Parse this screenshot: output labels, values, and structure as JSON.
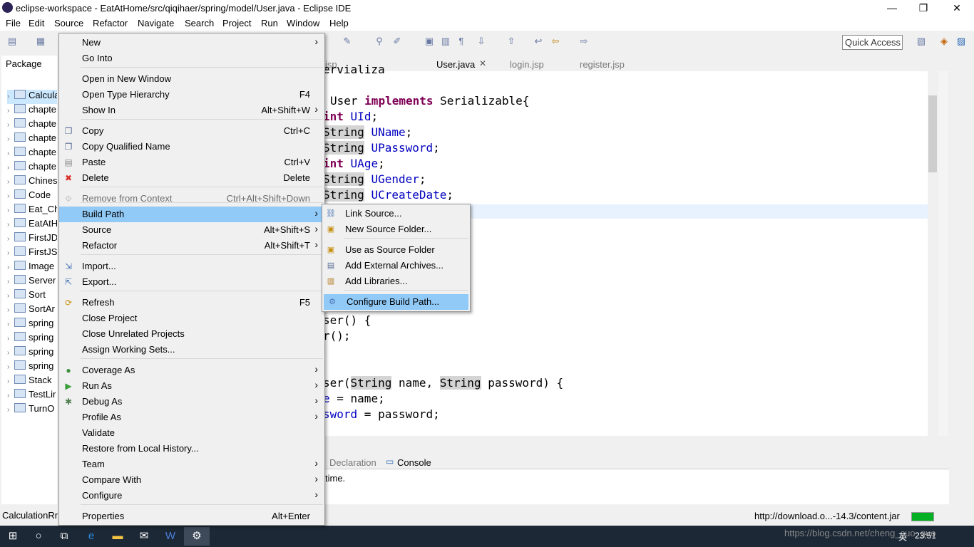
{
  "window": {
    "title": "eclipse-workspace - EatAtHome/src/qiqihaer/spring/model/User.java - Eclipse IDE",
    "minimize": "—",
    "restore": "❐",
    "close": "✕"
  },
  "menubar": [
    "File",
    "Edit",
    "Source",
    "Refactor",
    "Navigate",
    "Search",
    "Project",
    "Run",
    "Window",
    "Help"
  ],
  "toolbar": {
    "quick_access": "Quick Access"
  },
  "package_explorer": {
    "tab": "Package",
    "items": [
      "Calcula",
      "chapte",
      "chapte",
      "chapte",
      "chapte",
      "chapte",
      "Chines",
      "Code",
      "Eat_Ch",
      "EatAtH",
      "FirstJD",
      "FirstJS",
      "Image",
      "Server",
      "Sort",
      "SortAr",
      "spring",
      "spring",
      "spring",
      "spring",
      "Stack",
      "TestLir",
      "TurnO"
    ]
  },
  "editor": {
    "tabs": [
      "jsp",
      "User.java",
      "login.jsp",
      "register.jsp"
    ],
    "code": {
      "line0": "ervializa",
      "class_name": "User",
      "implements": "implements",
      "iface": "Serializable{",
      "f1_type": "int",
      "f1_name": "UId",
      "f2_type": "String",
      "f2_name": "UName",
      "f3_type": "String",
      "f3_name": "UPassword",
      "f4_type": "int",
      "f4_name": "UAge",
      "f5_type": "String",
      "f5_name": "UGender",
      "f6_type": "String",
      "f6_name": "UCreateDate",
      "ctor1": "ser() {",
      "ctor1b": "r();",
      "ctor2a": "ser(",
      "ctor2_t1": "String",
      "ctor2_p1": " name, ",
      "ctor2_t2": "String",
      "ctor2_p2": " password) {",
      "assign1_a": "e",
      "assign1_b": " = name;",
      "assign2_a": "sword",
      "assign2_b": " = password;"
    }
  },
  "bottom_panel": {
    "tabs": [
      "Declaration",
      "Console"
    ],
    "text": "time."
  },
  "status": {
    "left": "CalculationRr",
    "url": "http://download.o...-14.3/content.jar"
  },
  "context_menu": {
    "items": [
      {
        "label": "New",
        "shortcut": "",
        "submenu": true
      },
      {
        "label": "Go Into",
        "shortcut": "",
        "submenu": false
      },
      {
        "label": "Open in New Window",
        "shortcut": "",
        "submenu": false
      },
      {
        "label": "Open Type Hierarchy",
        "shortcut": "F4",
        "submenu": false
      },
      {
        "label": "Show In",
        "shortcut": "Alt+Shift+W",
        "submenu": true
      },
      {
        "label": "Copy",
        "shortcut": "Ctrl+C",
        "submenu": false
      },
      {
        "label": "Copy Qualified Name",
        "shortcut": "",
        "submenu": false
      },
      {
        "label": "Paste",
        "shortcut": "Ctrl+V",
        "submenu": false
      },
      {
        "label": "Delete",
        "shortcut": "Delete",
        "submenu": false
      },
      {
        "label": "Remove from Context",
        "shortcut": "Ctrl+Alt+Shift+Down",
        "submenu": false
      },
      {
        "label": "Build Path",
        "shortcut": "",
        "submenu": true
      },
      {
        "label": "Source",
        "shortcut": "Alt+Shift+S",
        "submenu": true
      },
      {
        "label": "Refactor",
        "shortcut": "Alt+Shift+T",
        "submenu": true
      },
      {
        "label": "Import...",
        "shortcut": "",
        "submenu": false
      },
      {
        "label": "Export...",
        "shortcut": "",
        "submenu": false
      },
      {
        "label": "Refresh",
        "shortcut": "F5",
        "submenu": false
      },
      {
        "label": "Close Project",
        "shortcut": "",
        "submenu": false
      },
      {
        "label": "Close Unrelated Projects",
        "shortcut": "",
        "submenu": false
      },
      {
        "label": "Assign Working Sets...",
        "shortcut": "",
        "submenu": false
      },
      {
        "label": "Coverage As",
        "shortcut": "",
        "submenu": true
      },
      {
        "label": "Run As",
        "shortcut": "",
        "submenu": true
      },
      {
        "label": "Debug As",
        "shortcut": "",
        "submenu": true
      },
      {
        "label": "Profile As",
        "shortcut": "",
        "submenu": true
      },
      {
        "label": "Validate",
        "shortcut": "",
        "submenu": false
      },
      {
        "label": "Restore from Local History...",
        "shortcut": "",
        "submenu": false
      },
      {
        "label": "Team",
        "shortcut": "",
        "submenu": true
      },
      {
        "label": "Compare With",
        "shortcut": "",
        "submenu": true
      },
      {
        "label": "Configure",
        "shortcut": "",
        "submenu": true
      },
      {
        "label": "Properties",
        "shortcut": "Alt+Enter",
        "submenu": false
      }
    ]
  },
  "build_path_submenu": {
    "items": [
      "Link Source...",
      "New Source Folder...",
      "Use as Source Folder",
      "Add External Archives...",
      "Add Libraries...",
      "Configure Build Path..."
    ]
  },
  "taskbar": {
    "watermark": "https://blog.csdn.net/cheng_cuo_guo",
    "ime": "英",
    "clock": "23:51"
  }
}
